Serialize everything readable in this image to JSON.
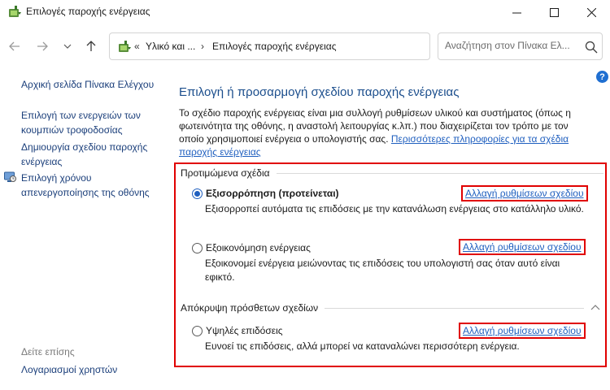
{
  "window": {
    "title": "Επιλογές παροχής ενέργειας",
    "icon": "power-options-icon"
  },
  "address": {
    "crumbs": [
      "Υλικό και ...",
      "Επιλογές παροχής ενέργειας"
    ],
    "search_placeholder": "Αναζήτηση στον Πίνακα Ελ..."
  },
  "help": {
    "label": "?"
  },
  "sidebar": {
    "home": "Αρχική σελίδα Πίνακα Ελέγχου",
    "items": [
      "Επιλογή των ενεργειών των κουμπιών τροφοδοσίας",
      "Δημιουργία σχεδίου παροχής ενέργειας",
      "Επιλογή χρόνου απενεργοποίησης της οθόνης"
    ],
    "see_also": "Δείτε επίσης",
    "accounts": "Λογαριασμοί χρηστών"
  },
  "main": {
    "title": "Επιλογή ή προσαρμογή σχεδίου παροχής ενέργειας",
    "description": "Το σχέδιο παροχής ενέργειας είναι μια συλλογή ρυθμίσεων υλικού και συστήματος (όπως η φωτεινότητα της οθόνης, η αναστολή λειτουργίας κ.λπ.) που διαχειρίζεται τον τρόπο με τον οποίο χρησιμοποιεί ενέργεια ο υπολογιστής σας.",
    "more_info_link": "Περισσότερες πληροφορίες για τα σχέδια παροχής ενέργειας",
    "preferred_label": "Προτιμώμενα σχέδια",
    "hidden_label": "Απόκρυψη πρόσθετων σχεδίων",
    "change_label": "Αλλαγή ρυθμίσεων σχεδίου",
    "plans": [
      {
        "name": "Εξισορρόπηση (προτείνεται)",
        "description": "Εξισορροπεί αυτόματα τις επιδόσεις με την κατανάλωση ενέργειας στο κατάλληλο υλικό.",
        "selected": true
      },
      {
        "name": "Εξοικονόμηση ενέργειας",
        "description": "Εξοικονομεί ενέργεια μειώνοντας τις επιδόσεις του υπολογιστή σας όταν αυτό είναι εφικτό.",
        "selected": false
      },
      {
        "name": "Υψηλές επιδόσεις",
        "description": "Ευνοεί τις επιδόσεις, αλλά μπορεί να καταναλώνει περισσότερη ενέργεια.",
        "selected": false
      }
    ]
  },
  "colors": {
    "accent": "#1f5fbf",
    "heading": "#1a4d8c",
    "highlight": "#e00000"
  }
}
